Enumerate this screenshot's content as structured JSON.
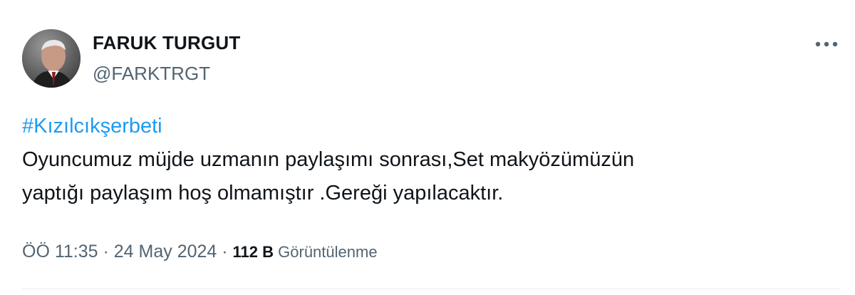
{
  "author": {
    "display_name": "FARUK TURGUT",
    "handle": "@FARKTRGT"
  },
  "more_icon": "more-horizontal-icon",
  "tweet": {
    "hashtag": "#Kızılcıkşerbeti",
    "text_line1": "Oyuncumuz müjde uzmanın paylaşımı sonrası,Set makyözümüzün",
    "text_line2": "yaptığı paylaşım hoş olmamıştır .Gereği yapılacaktır."
  },
  "meta": {
    "time": "ÖÖ 11:35",
    "separator1": " · ",
    "date": "24 May 2024",
    "separator2": " · ",
    "views_count": "112 B",
    "views_label": " Görüntülenme"
  },
  "colors": {
    "link": "#1d9bf0",
    "secondary_text": "#536471",
    "primary_text": "#0f1419"
  }
}
